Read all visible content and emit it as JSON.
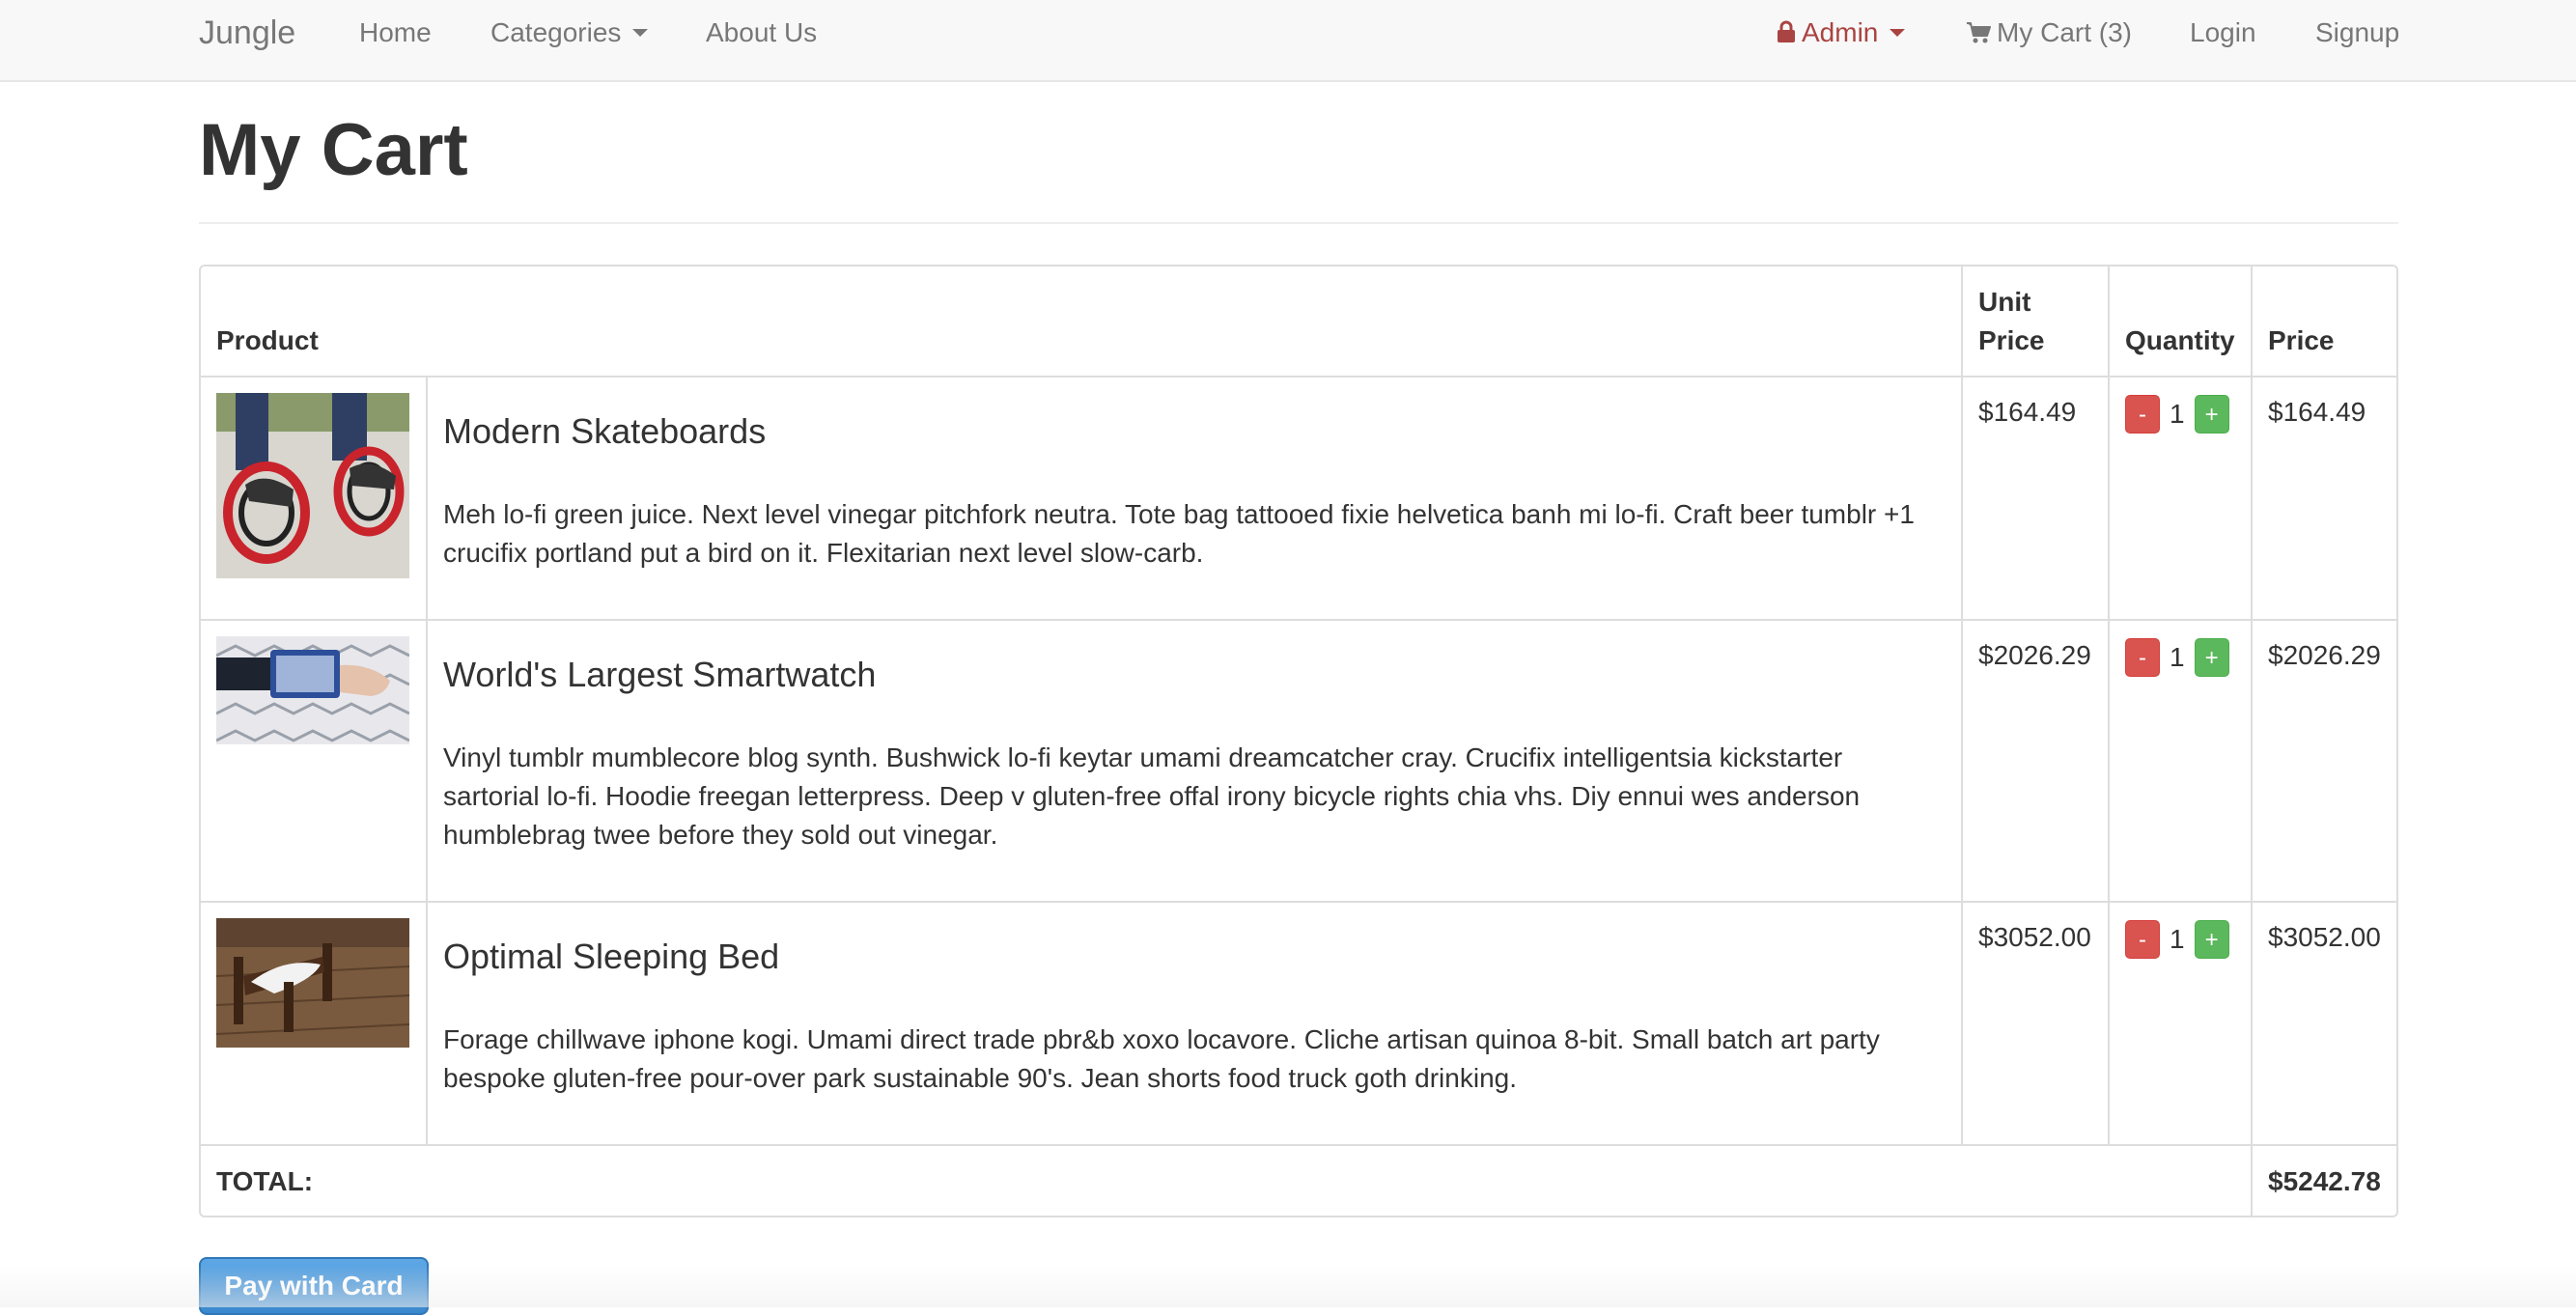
{
  "navbar": {
    "brand": "Jungle",
    "links": {
      "home": "Home",
      "categories": "Categories",
      "about": "About Us"
    },
    "right": {
      "admin": "Admin",
      "cart": "My Cart (3)",
      "login": "Login",
      "signup": "Signup"
    },
    "admin_color": "#a94442"
  },
  "page": {
    "title": "My Cart"
  },
  "table": {
    "headers": {
      "product": "Product",
      "unit_price": "Unit Price",
      "quantity": "Quantity",
      "price": "Price"
    },
    "items": [
      {
        "name": "Modern Skateboards",
        "description": "Meh lo-fi green juice. Next level vinegar pitchfork neutra. Tote bag tattooed fixie helvetica banh mi lo-fi. Craft beer tumblr +1 crucifix portland put a bird on it. Flexitarian next level slow-carb.",
        "unit_price": "$164.49",
        "quantity": "1",
        "price": "$164.49"
      },
      {
        "name": "World's Largest Smartwatch",
        "description": "Vinyl tumblr mumblecore blog synth. Bushwick lo-fi keytar umami dreamcatcher cray. Crucifix intelligentsia kickstarter sartorial lo-fi. Hoodie freegan letterpress. Deep v gluten-free offal irony bicycle rights chia vhs. Diy ennui wes anderson humblebrag twee before they sold out vinegar.",
        "unit_price": "$2026.29",
        "quantity": "1",
        "price": "$2026.29"
      },
      {
        "name": "Optimal Sleeping Bed",
        "description": "Forage chillwave iphone kogi. Umami direct trade pbr&b xoxo locavore. Cliche artisan quinoa 8-bit. Small batch art party bespoke gluten-free pour-over park sustainable 90's. Jean shorts food truck goth drinking.",
        "unit_price": "$3052.00",
        "quantity": "1",
        "price": "$3052.00"
      }
    ],
    "qty_minus": "-",
    "qty_plus": "+",
    "total_label": "TOTAL:",
    "total_value": "$5242.78"
  },
  "actions": {
    "pay": "Pay with Card"
  },
  "icons": {
    "lock": "lock-icon",
    "cart": "cart-icon"
  }
}
